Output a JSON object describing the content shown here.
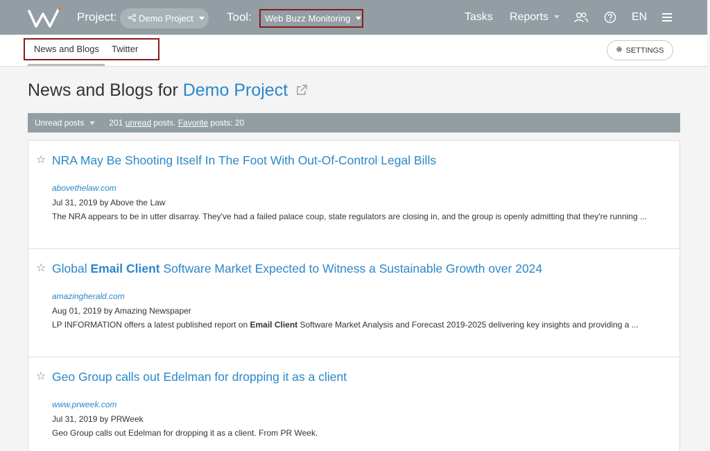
{
  "topbar": {
    "project_label": "Project:",
    "project_value": "Demo Project",
    "tool_label": "Tool:",
    "tool_value": "Web Buzz Monitoring",
    "tasks": "Tasks",
    "reports": "Reports",
    "language": "EN",
    "icons": [
      "logo-w",
      "share-icon",
      "users-icon",
      "help-icon",
      "hamburger-menu-icon"
    ]
  },
  "tabs": [
    {
      "label": "News and Blogs",
      "active": true
    },
    {
      "label": "Twitter",
      "active": false
    }
  ],
  "settings_label": "SETTINGS",
  "page_title": {
    "prefix": "News and Blogs for ",
    "project": "Demo Project"
  },
  "filterbar": {
    "filter": "Unread posts",
    "count": "201",
    "unread": "unread",
    "posts_text": "posts.",
    "favorite": "Favorite",
    "favorite_text": "posts: 20"
  },
  "posts": [
    {
      "title_parts": [
        "NRA May Be Shooting Itself In The Foot With Out-Of-Control Legal Bills"
      ],
      "source": "abovethelaw.com",
      "meta": "Jul 31, 2019 by Above the Law",
      "excerpt_parts": [
        "The NRA appears to be in utter disarray. They've had a failed palace coup, state regulators are closing in, and the group is openly admitting that they're running ..."
      ]
    },
    {
      "title_parts": [
        "Global ",
        "Email Client",
        " Software Market Expected to Witness a Sustainable Growth over 2024"
      ],
      "source": "amazingherald.com",
      "meta": "Aug 01, 2019 by Amazing Newspaper",
      "excerpt_parts": [
        "LP INFORMATION offers a latest published report on ",
        "Email Client",
        " Software Market Analysis and Forecast 2019-2025 delivering key insights and providing a ..."
      ]
    },
    {
      "title_parts": [
        "Geo Group calls out Edelman for dropping it as a client"
      ],
      "source": "www.prweek.com",
      "meta": "Jul 31, 2019 by PRWeek",
      "excerpt_parts": [
        "Geo Group calls out Edelman for dropping it as a client. From PR Week."
      ]
    }
  ],
  "colors": {
    "topbar": "#929ea3",
    "link": "#2b87c9",
    "highlight_box": "#8b1a1a"
  }
}
